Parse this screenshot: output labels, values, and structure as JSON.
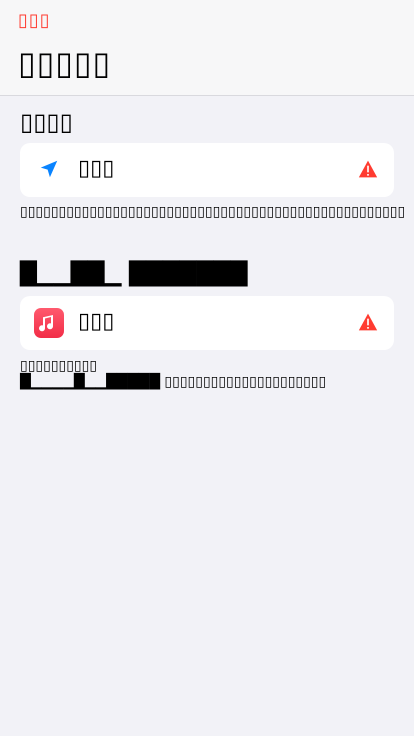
{
  "nav": {
    "back_label": "▯▯▯",
    "title": "▯▯▯▯▯"
  },
  "section": {
    "title": "▯▯▯▯"
  },
  "rows": [
    {
      "label": "▯▯▯",
      "icon": "location-arrow-icon",
      "status_icon": "warning-icon"
    },
    {
      "label": "▯▯▯",
      "icon": "music-app-icon",
      "status_icon": "warning-icon"
    }
  ],
  "descriptions": {
    "first": "▯▯▯▯▯▯▯▯▯▯▯▯▯▯▯▯▯▯▯▯▯▯▯▯▯▯▯▯▯▯▯▯▯▯▯▯▯▯▯▯▯▯▯▯▯▯▯▯▯▯",
    "link_row": "█▁▁██▁ ███████",
    "second_line1": "▯▯▯▯▯▯▯▯▯▯",
    "second_heavy": "█▁▁▁▁█▁▁█████",
    "second_tail": "▯▯▯▯▯▯▯▯▯▯▯▯▯▯▯▯▯▯▯▯▯"
  },
  "colors": {
    "accent_red": "#ff3b30",
    "location_blue": "#0a84ff",
    "music_gradient_top": "#ff5a6e",
    "music_gradient_bottom": "#f22d47",
    "card_bg": "#ffffff",
    "page_bg": "#f2f2f7"
  }
}
